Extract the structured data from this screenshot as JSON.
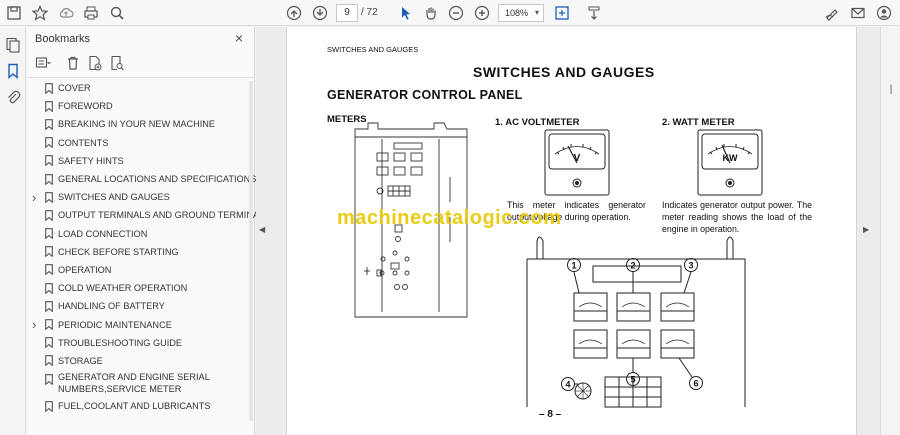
{
  "toolbar": {
    "page_current": "9",
    "page_total": "/ 72",
    "zoom": "108%"
  },
  "bookmarks": {
    "title": "Bookmarks",
    "close": "×",
    "items": [
      {
        "label": "COVER",
        "expandable": false
      },
      {
        "label": "FOREWORD",
        "expandable": false
      },
      {
        "label": "BREAKING IN YOUR NEW MACHINE",
        "expandable": false
      },
      {
        "label": "CONTENTS",
        "expandable": false
      },
      {
        "label": "SAFETY HINTS",
        "expandable": false
      },
      {
        "label": "GENERAL LOCATIONS AND SPECIFICATIONS",
        "expandable": false
      },
      {
        "label": "SWITCHES AND GAUGES",
        "expandable": true
      },
      {
        "label": "OUTPUT TERMINALS AND GROUND TERMINAL",
        "expandable": false
      },
      {
        "label": "LOAD CONNECTION",
        "expandable": false
      },
      {
        "label": "CHECK BEFORE STARTING",
        "expandable": false
      },
      {
        "label": "OPERATION",
        "expandable": false
      },
      {
        "label": "COLD WEATHER OPERATION",
        "expandable": false
      },
      {
        "label": "HANDLING OF BATTERY",
        "expandable": false
      },
      {
        "label": "PERIODIC MAINTENANCE",
        "expandable": true
      },
      {
        "label": "TROUBLESHOOTING GUIDE",
        "expandable": false
      },
      {
        "label": "STORAGE",
        "expandable": false
      },
      {
        "label": "GENERATOR AND ENGINE SERIAL NUMBERS,SERVICE METER",
        "expandable": false
      },
      {
        "label": "FUEL,COOLANT AND LUBRICANTS",
        "expandable": false
      }
    ]
  },
  "page": {
    "header_small": "SWITCHES AND GAUGES",
    "title": "SWITCHES AND GAUGES",
    "subtitle": "GENERATOR CONTROL PANEL",
    "meters_label": "METERS",
    "ac_voltmeter_heading": "1. AC VOLTMETER",
    "watt_meter_heading": "2. WATT METER",
    "ac_voltmeter_desc": "This meter indicates generator output voltage during operation.",
    "watt_meter_desc": "Indicates generator output power. The meter reading shows the load of the engine in operation.",
    "volt_unit": "V",
    "watt_unit": "KW",
    "watermark": "machinecatalogic.com",
    "callouts": [
      "1",
      "2",
      "3",
      "4",
      "5",
      "6"
    ],
    "page_number": "– 8 –"
  },
  "colors": {
    "watermark": "#e8c800",
    "toolbar_bg": "#f7f7f7",
    "accent_blue": "#1a5fb4"
  }
}
